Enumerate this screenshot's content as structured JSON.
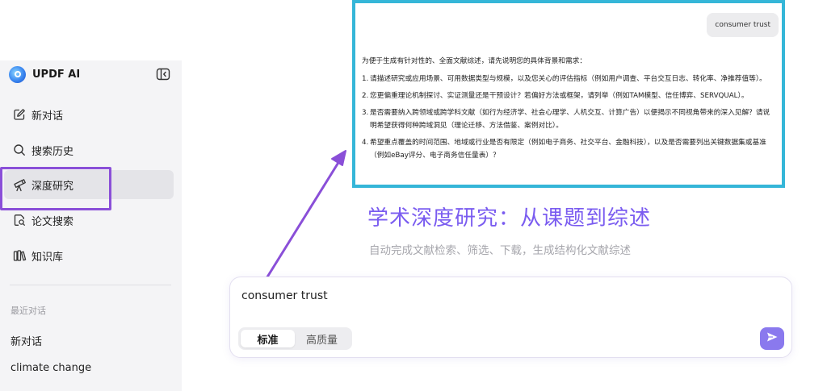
{
  "sidebar": {
    "brand": {
      "name": "UPDF AI"
    },
    "items": [
      {
        "label": "新对话",
        "icon": "edit-icon"
      },
      {
        "label": "搜索历史",
        "icon": "search-icon"
      },
      {
        "label": "深度研究",
        "icon": "telescope-icon",
        "active": true
      },
      {
        "label": "论文搜索",
        "icon": "document-search-icon"
      },
      {
        "label": "知识库",
        "icon": "books-icon"
      }
    ],
    "recent_title": "最近对话",
    "recent": [
      "新对话",
      "climate change"
    ]
  },
  "chat_preview": {
    "user_message": "consumer trust",
    "reply_intro": "为便于生成有针对性的、全面文献综述，请先说明您的具体背景和需求：",
    "reply_items": [
      {
        "num": "1.",
        "text": "请描述研究或应用场景、可用数据类型与规模，以及您关心的评估指标（例如用户调查、平台交互日志、转化率、净推荐值等）。"
      },
      {
        "num": "2.",
        "text": "您更偏重理论机制探讨、实证测量还是干预设计？若偏好方法或框架，请列举（例如TAM模型、信任博弈、SERVQUAL）。"
      },
      {
        "num": "3.",
        "text": "是否需要纳入跨领域或跨学科文献（如行为经济学、社会心理学、人机交互、计算广告）以便揭示不同视角带来的深入见解？请说明希望获得何种跨域洞见（理论迁移、方法借鉴、案例对比）。"
      },
      {
        "num": "4.",
        "text": "希望重点覆盖的时间范围、地域或行业是否有限定（例如电子商务、社交平台、金融科技），以及是否需要列出关键数据集或基准（例如eBay评分、电子商务信任量表）？"
      }
    ]
  },
  "hero": {
    "title": "学术深度研究：从课题到综述",
    "subtitle": "自动完成文献检索、筛选、下载，生成结构化文献综述"
  },
  "composer": {
    "input_value": "consumer trust",
    "modes": [
      "标准",
      "高质量"
    ],
    "active_mode": "标准",
    "send_icon": "send-icon"
  },
  "colors": {
    "accent": "#7a5cf0",
    "send": "#8a79ee",
    "highlight_purple": "#8a4fd8",
    "highlight_cyan": "#35b6d8"
  }
}
